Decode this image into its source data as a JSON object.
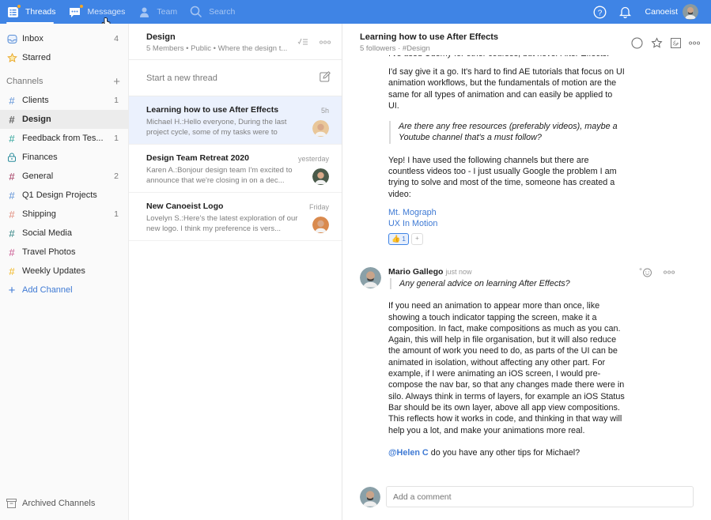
{
  "topbar": {
    "nav": [
      {
        "label": "Threads",
        "icon": "threads-icon",
        "badge": true,
        "active": true
      },
      {
        "label": "Messages",
        "icon": "messages-icon",
        "badge": true,
        "active": false
      },
      {
        "label": "Team",
        "icon": "team-icon",
        "badge": false,
        "active": false
      },
      {
        "label": "Search",
        "icon": "search-icon",
        "badge": false,
        "active": false
      }
    ],
    "user_name": "Canoeist",
    "accent": "#3f84e5",
    "badge_color": "#f5a623"
  },
  "sidebar": {
    "top_items": [
      {
        "label": "Inbox",
        "count": "4",
        "icon": "inbox-icon"
      },
      {
        "label": "Starred",
        "count": "",
        "icon": "star-icon"
      }
    ],
    "channels_label": "Channels",
    "channels": [
      {
        "label": "Clients",
        "count": "1",
        "color": "#5a8fd6",
        "icon": "hash"
      },
      {
        "label": "Design",
        "count": "",
        "color": "#666666",
        "icon": "hash",
        "active": true
      },
      {
        "label": "Feedback from Tes...",
        "count": "1",
        "color": "#2aa198",
        "icon": "hash"
      },
      {
        "label": "Finances",
        "count": "",
        "color": "#2a8c9c",
        "icon": "lock"
      },
      {
        "label": "General",
        "count": "2",
        "color": "#a0325a",
        "icon": "hash"
      },
      {
        "label": "Q1 Design Projects",
        "count": "",
        "color": "#5a8fd6",
        "icon": "hash"
      },
      {
        "label": "Shipping",
        "count": "1",
        "color": "#e08a7a",
        "icon": "hash"
      },
      {
        "label": "Social Media",
        "count": "",
        "color": "#2a7f7f",
        "icon": "hash"
      },
      {
        "label": "Travel Photos",
        "count": "",
        "color": "#c9558f",
        "icon": "hash"
      },
      {
        "label": "Weekly Updates",
        "count": "",
        "color": "#f2b51d",
        "icon": "hash"
      }
    ],
    "add_channel": "Add Channel",
    "archived": "Archived Channels"
  },
  "threadlist": {
    "title": "Design",
    "subtitle": "5 Members • Public • Where the design t...",
    "new_thread_placeholder": "Start a new thread",
    "threads": [
      {
        "title": "Learning how to use After Effects",
        "time": "5h",
        "snippet": "Michael H.:Hello everyone, During the last project cycle, some of my tasks were to",
        "active": true,
        "avatar_color": "#e9c79a"
      },
      {
        "title": "Design Team Retreat 2020",
        "time": "yesterday",
        "snippet": "Karen A.:Bonjour design team    I'm excited to announce that we're closing in on a dec...",
        "active": false,
        "avatar_color": "#4a5a4a"
      },
      {
        "title": "New Canoeist Logo",
        "time": "Friday",
        "snippet": "Lovelyn S.:Here's the latest exploration of our new logo. I think my preference is vers...",
        "active": false,
        "avatar_color": "#d98a4e"
      }
    ]
  },
  "thread": {
    "title": "Learning how to use After Effects",
    "followers": "5 followers",
    "channel": "#Design",
    "clipped_line": "I've used Udemy for other courses, but never After Effects.",
    "para1": "I'd say give it a go. It's hard to find AE tutorials that focus on UI animation workflows, but the fundamentals of motion are the same for all types of animation and can easily be applied to UI.",
    "quote1": "Are there any free resources (preferably videos), maybe a Youtube channel that's a must follow?",
    "para2": "Yep! I have used the following channels but there are countless videos too - I just usually Google the problem I am trying to solve and most of the time, someone has created a video:",
    "links": [
      "Mt. Mograph",
      "UX In Motion"
    ],
    "reaction": {
      "emoji": "👍",
      "count": "1",
      "add": "+"
    },
    "message": {
      "author": "Mario Gallego",
      "time": "just now",
      "quote": "Any general advice on learning After Effects?",
      "body": "If you need an animation to appear more than once, like showing a touch indicator tapping the screen, make it a composition. In fact, make compositions as much as you can. Again, this will help in file organisation, but it will also reduce the amount of work you need to do, as parts of the UI can be animated in isolation, without affecting any other part. For example, if I were animating an iOS screen, I would pre-compose the nav bar, so that any changes made there were in silo. Always think in terms of layers, for example an iOS Status Bar should be its own layer, above all app view compositions. This reflects how it works in code, and thinking in that way will help you a lot, and make your animations more real.",
      "mention": "@Helen C",
      "mention_text": " do you have any other tips for Michael?"
    },
    "comment_placeholder": "Add a comment"
  }
}
